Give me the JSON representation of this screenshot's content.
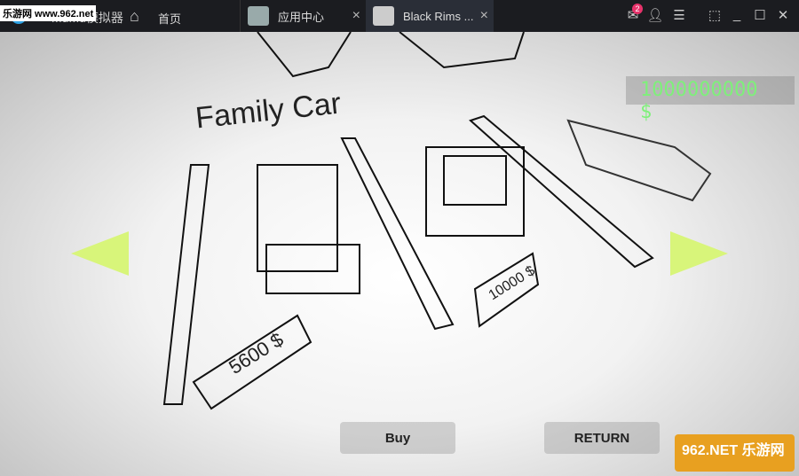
{
  "titlebar": {
    "app_name": "MuMu模拟器",
    "watermark": "乐游网 www.962.net",
    "home_label": "首页",
    "tabs": [
      {
        "label": "应用中心"
      },
      {
        "label": "Black Rims ..."
      }
    ],
    "close_glyph": "×",
    "mail_badge": "2",
    "accent": "#e8336b"
  },
  "game": {
    "category": "Family Car",
    "money": "1000000000 $",
    "price_left": "5600 $",
    "price_right": "10000 $",
    "buy_label": "Buy",
    "return_label": "RETURN",
    "arrow_color": "#d8f57a",
    "money_color": "#7ef07a"
  },
  "corner_logo": "962.NET 乐游网"
}
